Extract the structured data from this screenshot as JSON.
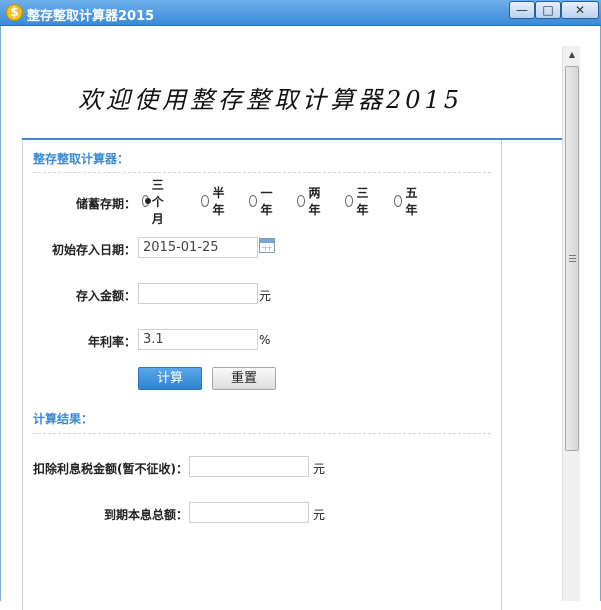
{
  "window": {
    "title": "整存整取计算器2015",
    "app_icon_glyph": "$",
    "minimize_glyph": "—",
    "maximize_glyph": "□",
    "close_glyph": "✕"
  },
  "banner": {
    "text": "欢迎使用整存整取计算器2015"
  },
  "calculator": {
    "section_title": "整存整取计算器：",
    "term_label": "储蓄存期：",
    "term_options": [
      "三个月",
      "半年",
      "一年",
      "两年",
      "三年",
      "五年"
    ],
    "term_selected_index": 0,
    "start_date_label": "初始存入日期：",
    "start_date_value": "2015-01-25",
    "amount_label": "存入金额：",
    "amount_value": "",
    "amount_unit": "元",
    "rate_label": "年利率：",
    "rate_value": "3.1",
    "rate_unit": "%",
    "calculate_label": "计算",
    "reset_label": "重置"
  },
  "results": {
    "section_title": "计算结果：",
    "tax_label": "扣除利息税金额(暂不征收)：",
    "tax_value": "",
    "tax_unit": "元",
    "total_label": "到期本息总额：",
    "total_value": "",
    "total_unit": "元"
  },
  "icons": {
    "app": "dollar-coin-icon",
    "calendar": "calendar-icon",
    "scroll_up": "chevron-up-icon",
    "scroll_grip": "grip-icon"
  },
  "colors": {
    "titlebar": "#3a8ad8",
    "accent": "#3b8bd4",
    "primary_button": "#2f82d0"
  }
}
